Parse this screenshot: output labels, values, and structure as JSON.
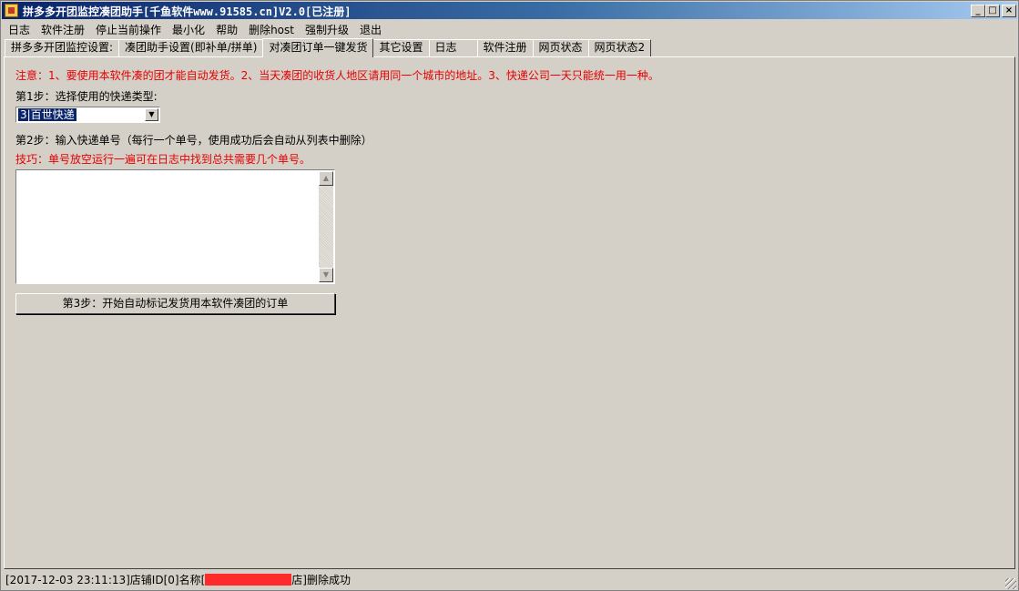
{
  "window": {
    "title": "拼多多开团监控凑团助手[千鱼软件www.91585.cn]V2.0[已注册]",
    "buttons": {
      "minimize": "_",
      "maximize": "□",
      "close": "×"
    }
  },
  "menu": [
    "日志",
    "软件注册",
    "停止当前操作",
    "最小化",
    "帮助",
    "删除host",
    "强制升级",
    "退出"
  ],
  "tabs": [
    {
      "label": "拼多多开团监控设置:",
      "active": false
    },
    {
      "label": "凑团助手设置(即补单/拼单)",
      "active": false
    },
    {
      "label": "对凑团订单一键发货",
      "active": true
    },
    {
      "label": "其它设置",
      "active": false
    },
    {
      "label": "日志",
      "active": false
    },
    {
      "label": "软件注册",
      "active": false
    },
    {
      "label": "网页状态",
      "active": false
    },
    {
      "label": "网页状态2",
      "active": false
    }
  ],
  "panel": {
    "notice": "注意：1、要使用本软件凑的团才能自动发货。2、当天凑团的收货人地区请用同一个城市的地址。3、快递公司一天只能统一用一种。",
    "step1_label": "第1步：选择使用的快递类型:",
    "courier_selected": "3|百世快递",
    "step2_label": "第2步：输入快递单号（每行一个单号，使用成功后会自动从列表中删除）",
    "tip": "技巧：单号放空运行一遍可在日志中找到总共需要几个单号。",
    "tracking_numbers": "",
    "step3_button": "第3步：开始自动标记发货用本软件凑团的订单"
  },
  "status": {
    "prefix": "[2017-12-03 23:11:13]店铺ID[0]名称[",
    "suffix": "店]删除成功"
  },
  "colors": {
    "accent": "#0a246a",
    "warning": "#e60000",
    "redaction": "#ff2a2a"
  }
}
